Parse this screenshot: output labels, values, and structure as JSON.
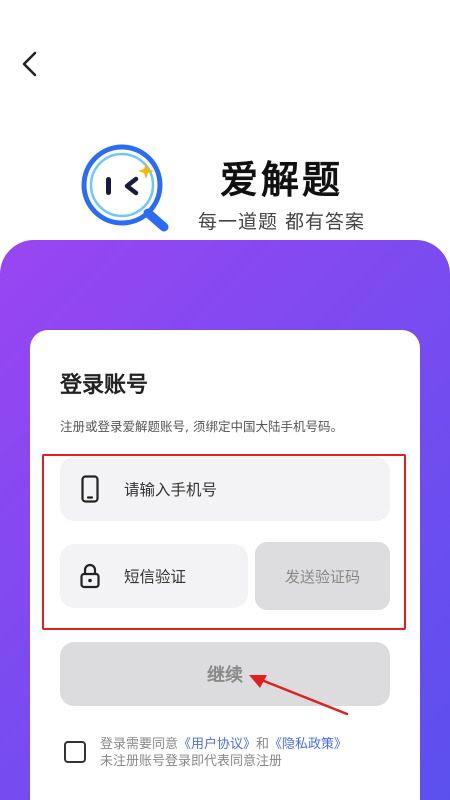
{
  "header": {
    "back_icon": "chevron-left-icon"
  },
  "brand": {
    "app_name": "爱解题",
    "slogan": "每一道题 都有答案",
    "logo_icon": "magnifier-face-icon"
  },
  "colors": {
    "gradient_start": "#9a45f2",
    "gradient_end": "#5b50ee",
    "logo_blue": "#2b6cf5",
    "link": "#4a6cf0",
    "highlight": "#e02020"
  },
  "login": {
    "title": "登录账号",
    "note": "注册或登录爱解题账号, 须绑定中国大陆手机号码。",
    "phone_placeholder": "请输入手机号",
    "phone_icon": "phone-icon",
    "code_placeholder": "短信验证",
    "code_icon": "lock-icon",
    "send_code_label": "发送验证码",
    "continue_label": "继续",
    "agree": {
      "prefix": "登录需要同意",
      "user_agreement": "《用户协议》",
      "and": "和",
      "privacy_policy": "《隐私政策》",
      "line2": "未注册账号登录即代表同意注册"
    }
  }
}
